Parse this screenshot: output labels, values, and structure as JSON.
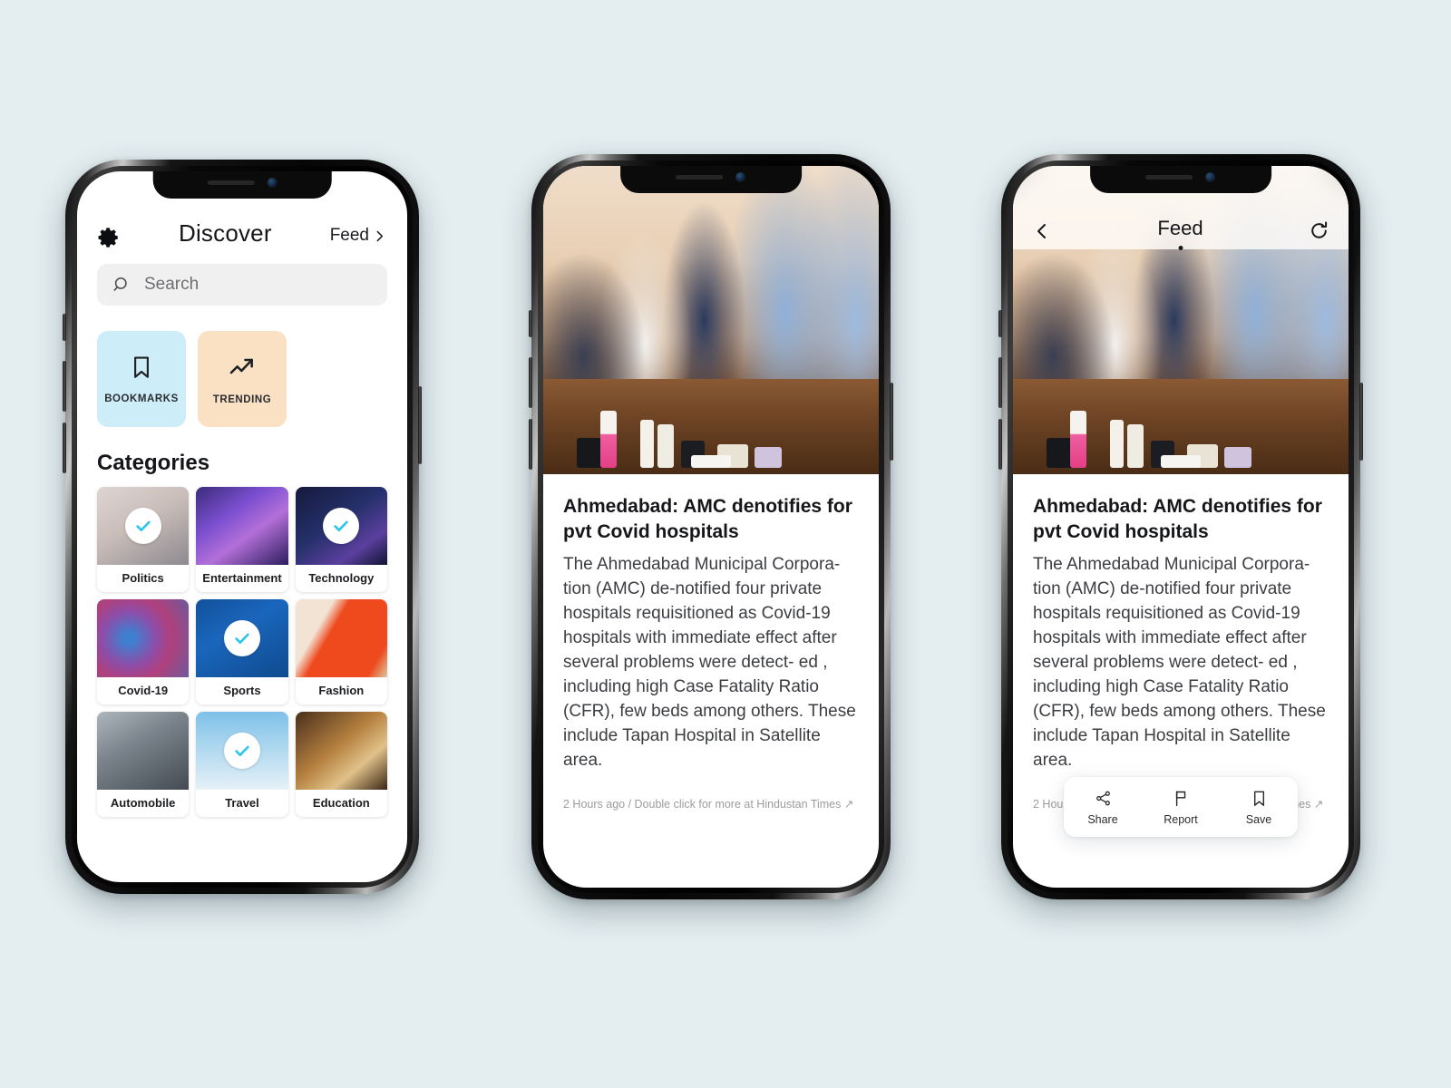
{
  "background_color": "#e4eef0",
  "accent_check_color": "#29c5ea",
  "phone1": {
    "name": "discover-screen",
    "header": {
      "title": "Discover",
      "feed_link": "Feed",
      "settings_icon": "gear-icon",
      "chevron_icon": "chevron-right-icon"
    },
    "search": {
      "placeholder": "Search",
      "icon": "search-icon"
    },
    "quick_tiles": [
      {
        "label": "BOOKMARKS",
        "icon": "bookmark-icon",
        "bg": "#cdeef9"
      },
      {
        "label": "TRENDING",
        "icon": "trending-up-icon",
        "bg": "#fae1c4"
      }
    ],
    "categories_heading": "Categories",
    "categories": [
      {
        "label": "Politics",
        "thumb": "th-politics",
        "selected": true
      },
      {
        "label": "Entertainment",
        "thumb": "th-entertainment",
        "selected": false
      },
      {
        "label": "Technology",
        "thumb": "th-technology",
        "selected": true
      },
      {
        "label": "Covid-19",
        "thumb": "th-covid",
        "selected": false
      },
      {
        "label": "Sports",
        "thumb": "th-sports",
        "selected": true
      },
      {
        "label": "Fashion",
        "thumb": "th-fashion",
        "selected": false
      },
      {
        "label": "Automobile",
        "thumb": "th-automobile",
        "selected": false
      },
      {
        "label": "Travel",
        "thumb": "th-travel",
        "selected": true
      },
      {
        "label": "Education",
        "thumb": "th-education",
        "selected": false
      }
    ]
  },
  "article": {
    "image_alt": "health workers in blue PPE at covid testing table",
    "title": "Ahmedabad: AMC denotifies for pvt Covid hospitals",
    "body": "The Ahmedabad Municipal Corpora- tion (AMC) de-notified four private hospitals requisitioned as Covid-19 hospitals with immediate effect after several problems were detect- ed , including high Case Fatality Ratio (CFR), few beds among others. These include Tapan Hospital in Satellite area.",
    "meta": "2 Hours ago / Double click for more at Hindustan Times ↗"
  },
  "phone3": {
    "name": "feed-detail-screen",
    "nav": {
      "title": "Feed",
      "back_icon": "chevron-left-icon",
      "refresh_icon": "refresh-icon"
    },
    "actions": [
      {
        "label": "Share",
        "icon": "share-icon"
      },
      {
        "label": "Report",
        "icon": "flag-icon"
      },
      {
        "label": "Save",
        "icon": "bookmark-icon"
      }
    ]
  }
}
